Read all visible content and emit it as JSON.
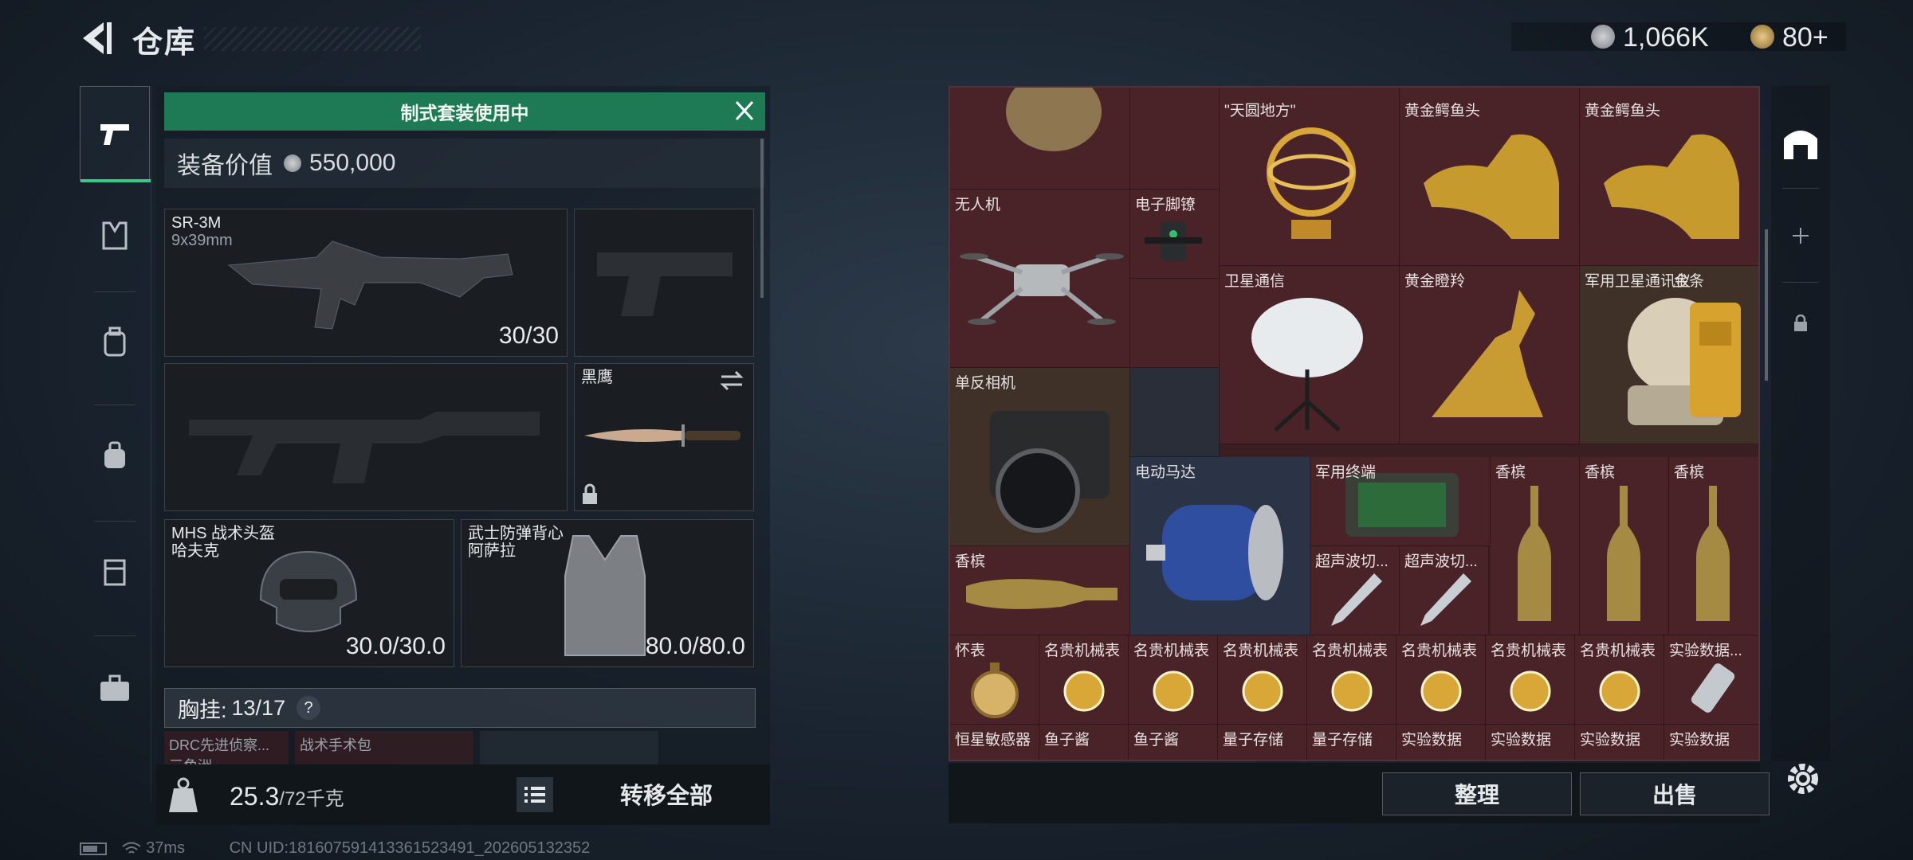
{
  "header": {
    "title": "仓库",
    "currency": [
      {
        "icon": "silver-coin-icon",
        "value": "1,066K"
      },
      {
        "icon": "gold-coin-icon",
        "value": "80+"
      }
    ]
  },
  "loadout": {
    "banner": "制式套装使用中",
    "value_label": "装备价值",
    "value": "550,000",
    "primary": {
      "name": "SR-3M",
      "caliber": "9x39mm",
      "ammo": "30/30"
    },
    "melee": {
      "name": "黑鹰"
    },
    "helmet": {
      "name": "MHS 战术头盔",
      "sub": "哈夫克",
      "durability": "30.0/30.0"
    },
    "armor": {
      "name": "武士防弹背心",
      "sub": "阿萨拉",
      "durability": "80.0/80.0"
    },
    "vest_label": "胸挂:",
    "vest_capacity": "13/17",
    "vest_help": "?",
    "vest_items": [
      "DRC先进侦察...",
      "战术手术包"
    ],
    "vest_sub": "三角洲",
    "weight": "25.3",
    "weight_max": "/72千克",
    "transfer_all": "转移全部"
  },
  "stash": {
    "items": [
      "\"天圆地方\"",
      "黄金鳄鱼头",
      "黄金鳄鱼头",
      "无人机",
      "电子脚镣",
      "卫星通信",
      "黄金瞪羚",
      "军用卫星通讯仪",
      "金条",
      "单反相机",
      "电动马达",
      "军用终端",
      "香槟",
      "香槟",
      "香槟",
      "香槟",
      "超声波切...",
      "超声波切...",
      "怀表",
      "名贵机械表",
      "名贵机械表",
      "名贵机械表",
      "名贵机械表",
      "名贵机械表",
      "名贵机械表",
      "名贵机械表",
      "实验数据...",
      "恒星敏感器",
      "鱼子酱",
      "鱼子酱",
      "量子存储",
      "量子存储",
      "实验数据",
      "实验数据",
      "实验数据",
      "实验数据"
    ],
    "organize": "整理",
    "sell": "出售"
  },
  "status": {
    "ping": "37ms",
    "uid": "CN UID:1816075914133615234​91_202605132352"
  },
  "colors": {
    "accent_green": "#1e7a55",
    "stash_cell": "#4a2328"
  }
}
